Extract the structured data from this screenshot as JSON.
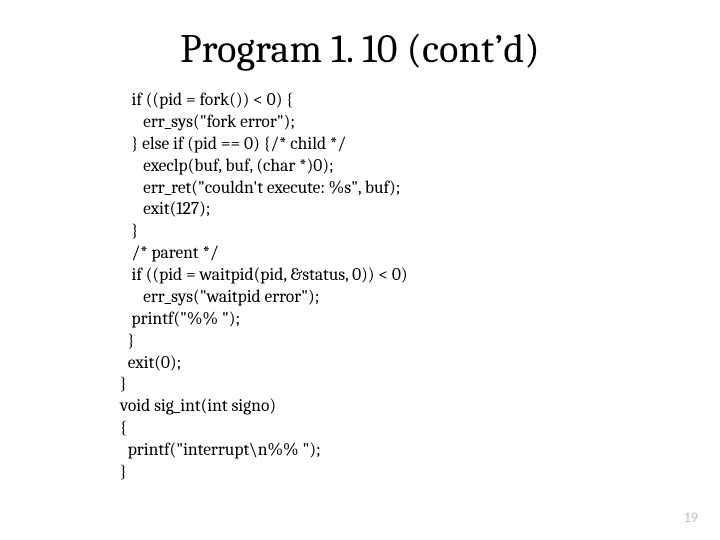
{
  "slide": {
    "title": "Program 1. 10 (cont’d)",
    "code": "   if ((pid = fork()) < 0) {\n      err_sys(\"fork error\");\n   } else if (pid == 0) {/* child */\n      execlp(buf, buf, (char *)0);\n      err_ret(\"couldn't execute: %s\", buf);\n      exit(127);\n   }\n   /* parent */\n   if ((pid = waitpid(pid, &status, 0)) < 0)\n      err_sys(\"waitpid error\");\n   printf(\"%% \");\n  }\n  exit(0);\n}\nvoid sig_int(int signo)\n{\n  printf(\"interrupt\\n%% \");\n}",
    "page_number": "19"
  }
}
